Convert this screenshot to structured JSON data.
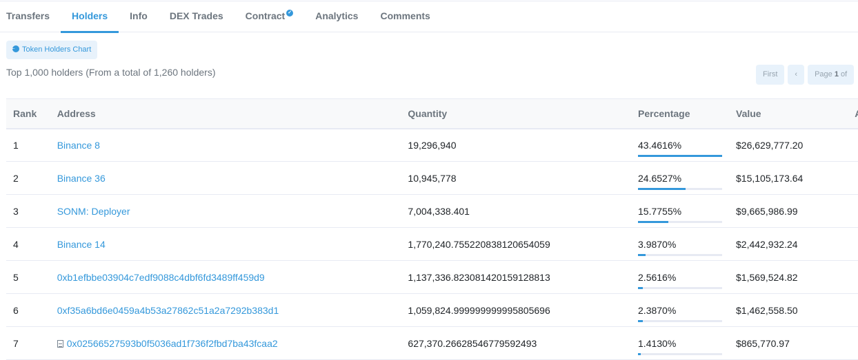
{
  "tabs": [
    "Transfers",
    "Holders",
    "Info",
    "DEX Trades",
    "Contract",
    "Analytics",
    "Comments"
  ],
  "active_tab": 1,
  "chart_button": "Token Holders Chart",
  "summary": "Top 1,000 holders (From a total of 1,260 holders)",
  "pager": {
    "first": "First",
    "prev": "‹",
    "page_prefix": "Page ",
    "page": "1",
    "page_suffix": " of"
  },
  "columns": [
    "Rank",
    "Address",
    "Quantity",
    "Percentage",
    "Value",
    "A"
  ],
  "rows": [
    {
      "rank": "1",
      "address": "Binance 8",
      "quantity": "19,296,940",
      "percentage": "43.4616%",
      "pct": 43.4616,
      "value": "$26,629,777.20",
      "contract": false
    },
    {
      "rank": "2",
      "address": "Binance 36",
      "quantity": "10,945,778",
      "percentage": "24.6527%",
      "pct": 24.6527,
      "value": "$15,105,173.64",
      "contract": false
    },
    {
      "rank": "3",
      "address": "SONM: Deployer",
      "quantity": "7,004,338.401",
      "percentage": "15.7755%",
      "pct": 15.7755,
      "value": "$9,665,986.99",
      "contract": false
    },
    {
      "rank": "4",
      "address": "Binance 14",
      "quantity": "1,770,240.755220838120654059",
      "percentage": "3.9870%",
      "pct": 3.987,
      "value": "$2,442,932.24",
      "contract": false
    },
    {
      "rank": "5",
      "address": "0xb1efbbe03904c7edf9088c4dbf6fd3489ff459d9",
      "quantity": "1,137,336.823081420159128813",
      "percentage": "2.5616%",
      "pct": 2.5616,
      "value": "$1,569,524.82",
      "contract": false
    },
    {
      "rank": "6",
      "address": "0xf35a6bd6e0459a4b53a27862c51a2a7292b383d1",
      "quantity": "1,059,824.999999999995805696",
      "percentage": "2.3870%",
      "pct": 2.387,
      "value": "$1,462,558.50",
      "contract": false
    },
    {
      "rank": "7",
      "address": "0x02566527593b0f5036ad1f736f2fbd7ba43fcaa2",
      "quantity": "627,370.26628546779592493",
      "percentage": "1.4130%",
      "pct": 1.413,
      "value": "$865,770.97",
      "contract": true
    }
  ],
  "accent": "#3498db"
}
